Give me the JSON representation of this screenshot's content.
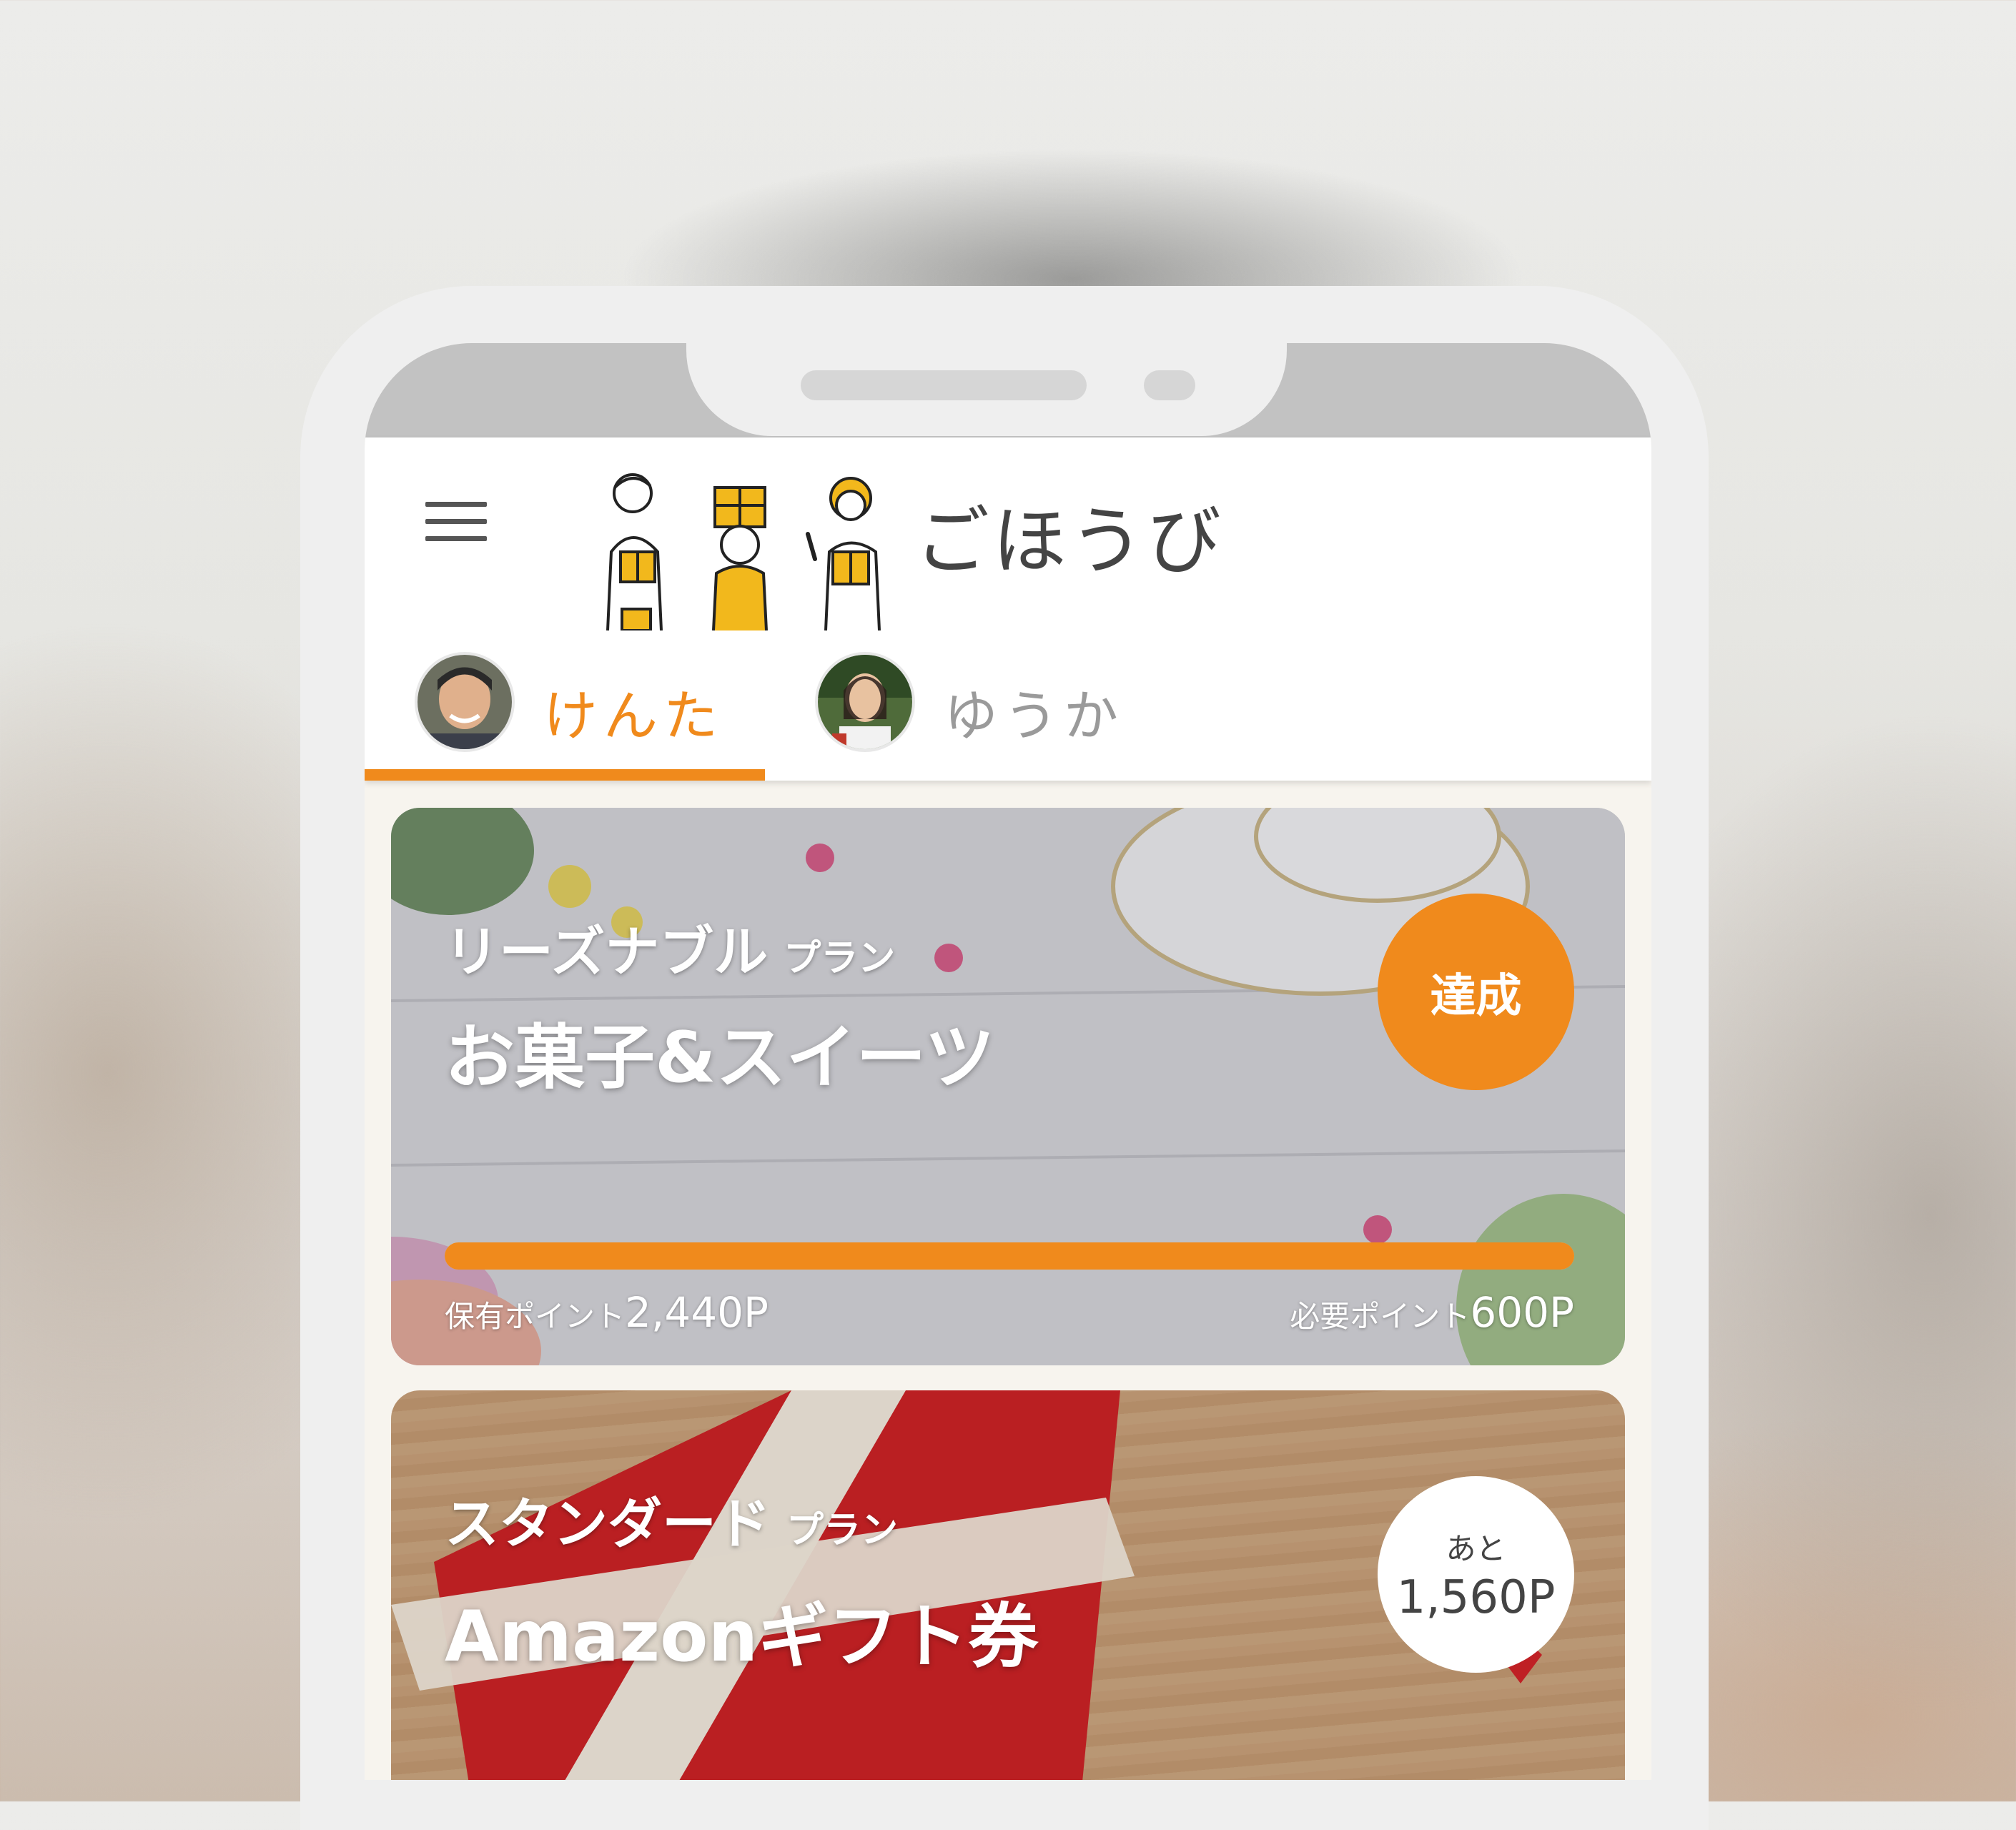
{
  "header": {
    "app_title": "ごほうび"
  },
  "tabs": [
    {
      "label": "けんた",
      "active": true
    },
    {
      "label": "ゆうか",
      "active": false
    }
  ],
  "colors": {
    "accent": "#f08a1c",
    "inactive_tab": "#9a9a9a"
  },
  "icons": {
    "menu": "hamburger-menu-icon",
    "logo": "family-gift-illustration"
  },
  "cards": [
    {
      "plan": "リーズナブル",
      "plan_suffix": "プラン",
      "title": "お菓子&スイーツ",
      "status_badge": "達成",
      "progress": 1.0,
      "owned_label": "保有ポイント",
      "owned_value": "2,440P",
      "required_label": "必要ポイント",
      "required_value": "600P"
    },
    {
      "plan": "スタンダード",
      "plan_suffix": "プラン",
      "title": "Amazonギフト券",
      "remaining_label": "あと",
      "remaining_value": "1,560P"
    }
  ]
}
